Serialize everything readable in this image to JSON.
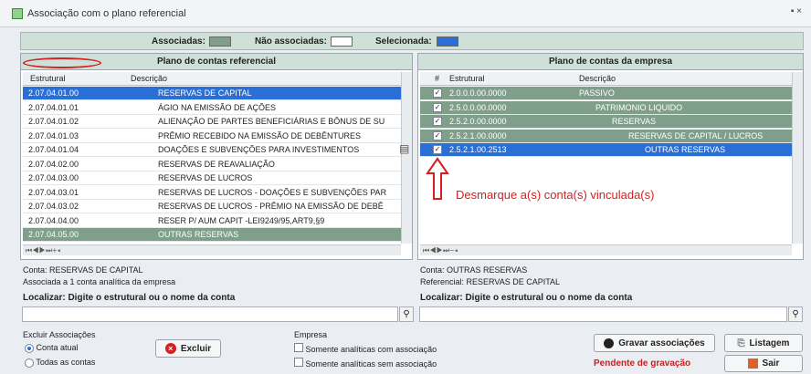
{
  "window": {
    "title": "Associação com o plano referencial",
    "control": "▪ ×"
  },
  "legend": {
    "associadas": "Associadas:",
    "nao_associadas": "Não associadas:",
    "selecionada": "Selecionada:",
    "colors": {
      "associadas": "#7f9f8a",
      "nao_associadas": "#ffffff",
      "selecionada": "#2a6fd6"
    }
  },
  "left_panel": {
    "title": "Plano de contas referencial",
    "columns": [
      "Estrutural",
      "Descrição"
    ],
    "rows": [
      {
        "code": "2.07.04.01.00",
        "desc": "RESERVAS DE CAPITAL",
        "state": "sel"
      },
      {
        "code": "2.07.04.01.01",
        "desc": "ÁGIO NA EMISSÃO DE AÇÕES",
        "state": "plain"
      },
      {
        "code": "2.07.04.01.02",
        "desc": "ALIENAÇÃO DE PARTES BENEFICIÁRIAS E BÔNUS DE SU",
        "state": "plain"
      },
      {
        "code": "2.07.04.01.03",
        "desc": "PRÊMIO RECEBIDO NA EMISSÃO DE DEBÊNTURES",
        "state": "plain"
      },
      {
        "code": "2.07.04.01.04",
        "desc": "DOAÇÕES E SUBVENÇÕES PARA INVESTIMENTOS",
        "state": "plain"
      },
      {
        "code": "2.07.04.02.00",
        "desc": "RESERVAS DE REAVALIAÇÃO",
        "state": "plain"
      },
      {
        "code": "2.07.04.03.00",
        "desc": "RESERVAS DE LUCROS",
        "state": "plain"
      },
      {
        "code": "2.07.04.03.01",
        "desc": "RESERVAS DE LUCROS - DOAÇÕES E SUBVENÇÕES PAR",
        "state": "plain"
      },
      {
        "code": "2.07.04.03.02",
        "desc": "RESERVAS DE LUCROS - PRÊMIO NA EMISSÃO DE DEBÊ",
        "state": "plain"
      },
      {
        "code": "2.07.04.04.00",
        "desc": "RESER P/ AUM CAPIT -LEI9249/95,ART9,§9",
        "state": "plain"
      },
      {
        "code": "2.07.04.05.00",
        "desc": "OUTRAS RESERVAS",
        "state": "assoc"
      }
    ],
    "nav": "⏮ ◀ ▶ ⏭ + ◂",
    "info_line1": "Conta: RESERVAS DE CAPITAL",
    "info_line2": "Associada a 1 conta analítica da empresa",
    "search_label": "Localizar: Digite o estrutural ou o nome da conta",
    "search_value": "",
    "search_icon": "magnifier-icon"
  },
  "right_panel": {
    "title": "Plano de contas da empresa",
    "columns": [
      "#",
      "Estrutural",
      "Descrição"
    ],
    "rows": [
      {
        "check": "✓",
        "code": "2.0.0.0.00.0000",
        "desc": "PASSIVO",
        "indent": 0,
        "state": "assoc"
      },
      {
        "check": "✓",
        "code": "2.5.0.0.00.0000",
        "desc": "PATRIMONIO LIQUIDO",
        "indent": 1,
        "state": "assoc"
      },
      {
        "check": "✓",
        "code": "2.5.2.0.00.0000",
        "desc": "RESERVAS",
        "indent": 2,
        "state": "assoc"
      },
      {
        "check": "✓",
        "code": "2.5.2.1.00.0000",
        "desc": "RESERVAS DE CAPITAL / LUCROS",
        "indent": 3,
        "state": "assoc"
      },
      {
        "check": "✓",
        "code": "2.5.2.1.00.2513",
        "desc": "OUTRAS RESERVAS",
        "indent": 4,
        "state": "sel"
      }
    ],
    "annotation": "Desmarque a(s) conta(s) vinculada(s)",
    "nav": "⏮ ◀ ▶ ⏭ − ◂",
    "info_line1": "Conta: OUTRAS RESERVAS",
    "info_line2": "Referencial: RESERVAS DE CAPITAL",
    "search_label": "Localizar: Digite o estrutural ou o nome da conta",
    "search_value": ""
  },
  "footer": {
    "excluir_group": "Excluir Associações",
    "radio_atual": "Conta atual",
    "radio_todas": "Todas as contas",
    "excluir_btn": "Excluir",
    "empresa_group": "Empresa",
    "check_com": "Somente analíticas com associação",
    "check_sem": "Somente analíticas sem associação",
    "gravar_btn": "Gravar associações",
    "listagem_btn": "Listagem",
    "pendente": "Pendente de gravação",
    "sair_btn": "Sair"
  }
}
